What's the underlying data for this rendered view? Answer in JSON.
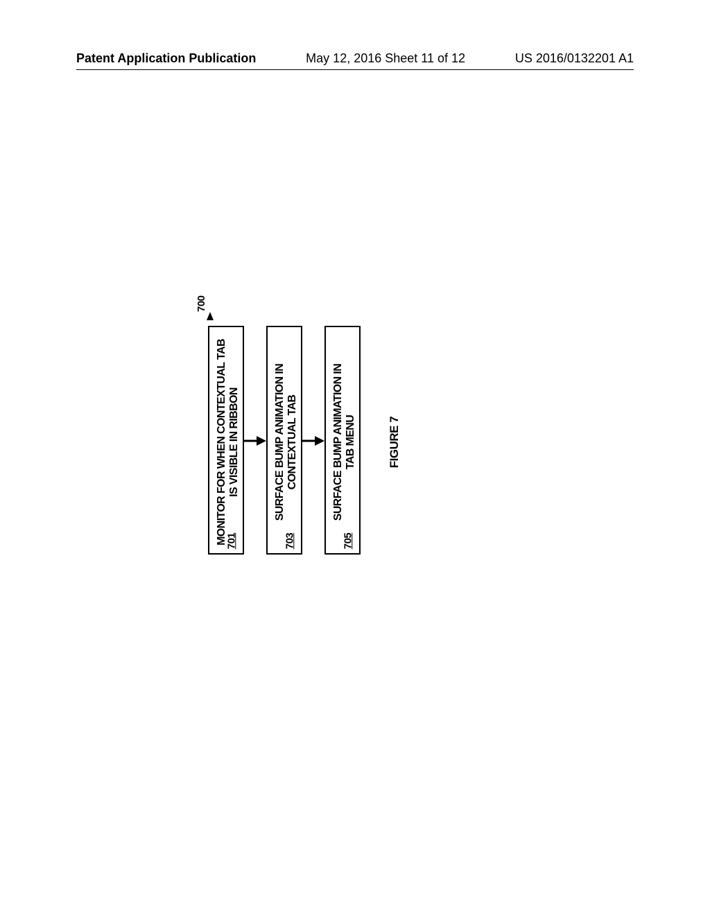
{
  "header": {
    "left": "Patent Application Publication",
    "center": "May 12, 2016  Sheet 11 of 12",
    "right": "US 2016/0132201 A1"
  },
  "diagram": {
    "ref": "700",
    "boxes": [
      {
        "id": "701",
        "line1": "MONITOR FOR WHEN CONTEXTUAL TAB",
        "line2": "IS VISIBLE IN RIBBON",
        "num": "701"
      },
      {
        "id": "703",
        "line1": "SURFACE BUMP ANIMATION IN",
        "line2": "CONTEXTUAL TAB",
        "num": "703"
      },
      {
        "id": "705",
        "line1": "SURFACE BUMP ANIMATION IN",
        "line2": "TAB MENU",
        "num": "705"
      }
    ],
    "caption": "FIGURE 7"
  }
}
